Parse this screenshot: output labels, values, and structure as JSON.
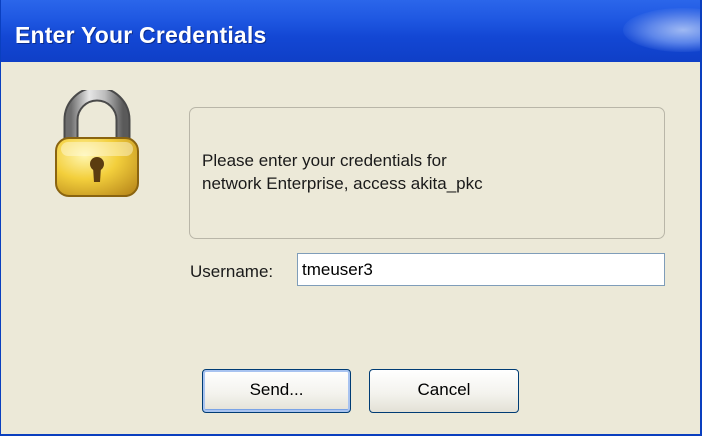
{
  "window": {
    "title": "Enter Your Credentials",
    "colors": {
      "titlebar": "#1f58e2",
      "body": "#ece9d8",
      "border": "#0a3fbf"
    }
  },
  "icon": "lock-icon",
  "message": {
    "line1": "Please enter your credentials for",
    "line2": "network Enterprise, access akita_pkc"
  },
  "username": {
    "label": "Username:",
    "value": "tmeuser3"
  },
  "buttons": {
    "send_label": "Send...",
    "cancel_label": "Cancel"
  }
}
